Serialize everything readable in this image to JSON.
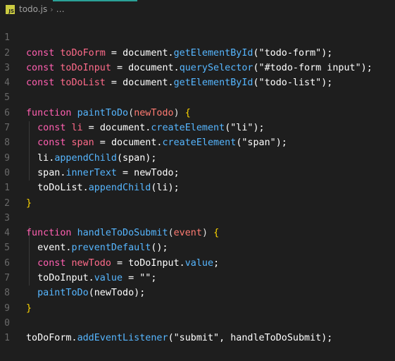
{
  "breadcrumb": {
    "file_icon_label": "JS",
    "file_name": "todo.js",
    "separator": "›",
    "more": "…"
  },
  "line_numbers": [
    "1",
    "2",
    "3",
    "4",
    "5",
    "6",
    "7",
    "8",
    "9",
    "0",
    "1",
    "2",
    "3",
    "4",
    "5",
    "6",
    "7",
    "8",
    "9",
    "0",
    "1"
  ],
  "code": {
    "l1": {
      "kw": "const",
      "name": "toDoForm",
      "eq": " = ",
      "obj": "document.",
      "fn": "getElementById",
      "arg": "(\"todo-form\");"
    },
    "l2": {
      "kw": "const",
      "name": "toDoInput",
      "eq": " = ",
      "obj": "document.",
      "fn": "querySelector",
      "arg": "(\"#todo-form input\");"
    },
    "l3": {
      "kw": "const",
      "name": "toDoList",
      "eq": " = ",
      "obj": "document.",
      "fn": "getElementById",
      "arg": "(\"todo-list\");"
    },
    "l5": {
      "kw": "function",
      "fn": "paintToDo",
      "open": "(",
      "param": "newTodo",
      "close": ") ",
      "brace": "{"
    },
    "l6": {
      "kw": "const",
      "name": "li",
      "eq": " = ",
      "obj": "document.",
      "fn": "createElement",
      "arg": "(\"li\");"
    },
    "l7": {
      "kw": "const",
      "name": "span",
      "eq": " = ",
      "obj": "document.",
      "fn": "createElement",
      "arg": "(\"span\");"
    },
    "l8": {
      "obj": "li.",
      "fn": "appendChild",
      "arg": "(span);"
    },
    "l9": {
      "obj": "span.",
      "prop": "innerText",
      "rest": " = newTodo;"
    },
    "l10": {
      "obj": "toDoList.",
      "fn": "appendChild",
      "arg": "(li);"
    },
    "l11": {
      "brace": "}"
    },
    "l13": {
      "kw": "function",
      "fn": "handleToDoSubmit",
      "open": "(",
      "param": "event",
      "close": ") ",
      "brace": "{"
    },
    "l14": {
      "obj": "event.",
      "fn": "preventDefault",
      "arg": "();"
    },
    "l15": {
      "kw": "const",
      "name": "newTodo",
      "eq": " = ",
      "obj": "toDoInput.",
      "prop": "value",
      "rest": ";"
    },
    "l16": {
      "obj": "toDoInput.",
      "prop": "value",
      "rest": " = \"\";"
    },
    "l17": {
      "fn": "paintToDo",
      "arg": "(newTodo);"
    },
    "l18": {
      "brace": "}"
    },
    "l20": {
      "obj": "toDoForm.",
      "fn": "addEventListener",
      "arg": "(\"submit\", handleToDoSubmit);"
    }
  }
}
